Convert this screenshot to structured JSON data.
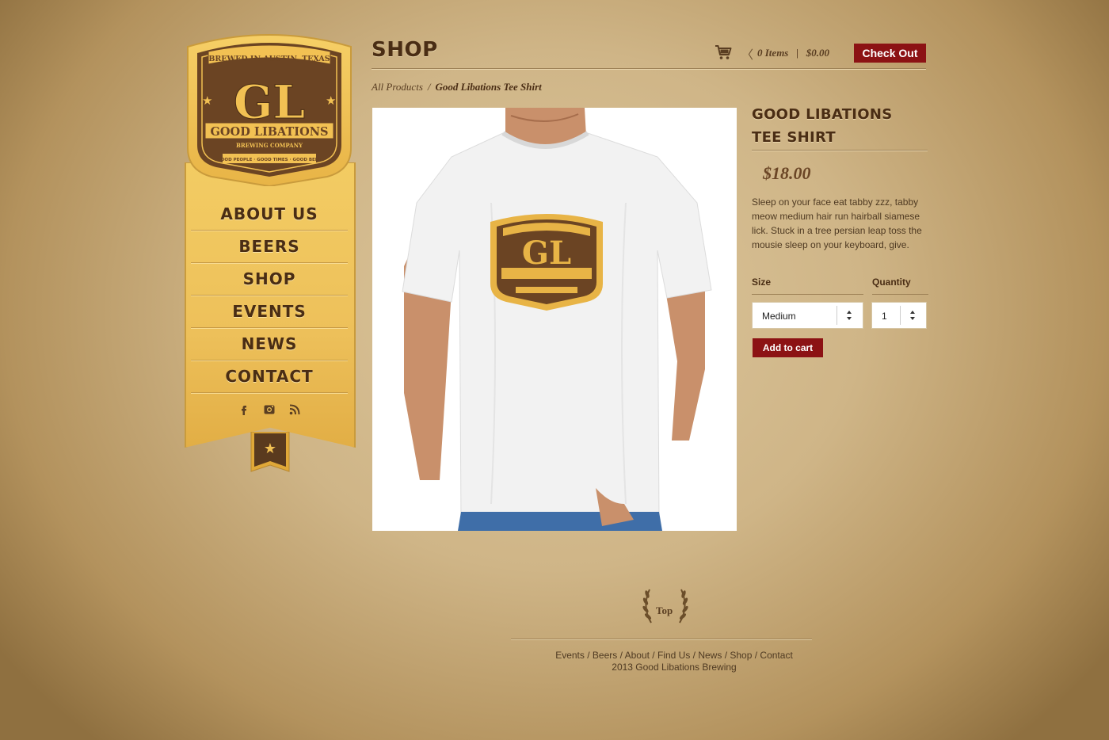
{
  "brand": {
    "ribbon_top": "BREWED IN AUSTIN, TEXAS",
    "monogram": "GL",
    "name": "GOOD LIBATIONS",
    "subtitle": "BREWING COMPANY",
    "tagline": "GOOD PEOPLE · GOOD TIMES · GOOD BEER",
    "colors": {
      "dark": "#6b4423",
      "gold": "#f2c153",
      "red": "#8c1214"
    }
  },
  "nav": {
    "items": [
      "ABOUT US",
      "BEERS",
      "SHOP",
      "EVENTS",
      "NEWS",
      "CONTACT"
    ],
    "social": [
      "facebook-icon",
      "instagram-icon",
      "rss-icon"
    ]
  },
  "header": {
    "title": "SHOP",
    "cart_count": "0 Items",
    "cart_divider": "|",
    "cart_total": "$0.00",
    "checkout_label": "Check Out"
  },
  "breadcrumb": {
    "root": "All Products",
    "separator": "/",
    "current": "Good Libations Tee Shirt"
  },
  "product": {
    "title_line1": "GOOD LIBATIONS",
    "title_line2": "TEE SHIRT",
    "price": "$18.00",
    "description": "Sleep on your face eat tabby zzz, tabby meow medium hair run hairball siamese lick. Stuck in a tree persian leap toss the mousie sleep on your keyboard, give.",
    "size_label": "Size",
    "size_value": "Medium",
    "quantity_label": "Quantity",
    "quantity_value": "1",
    "add_label": "Add to cart"
  },
  "footer": {
    "top_label": "Top",
    "links": [
      "Events",
      "Beers",
      "About",
      "Find Us",
      "News",
      "Shop",
      "Contact"
    ],
    "copyright": "2013 Good Libations Brewing"
  }
}
